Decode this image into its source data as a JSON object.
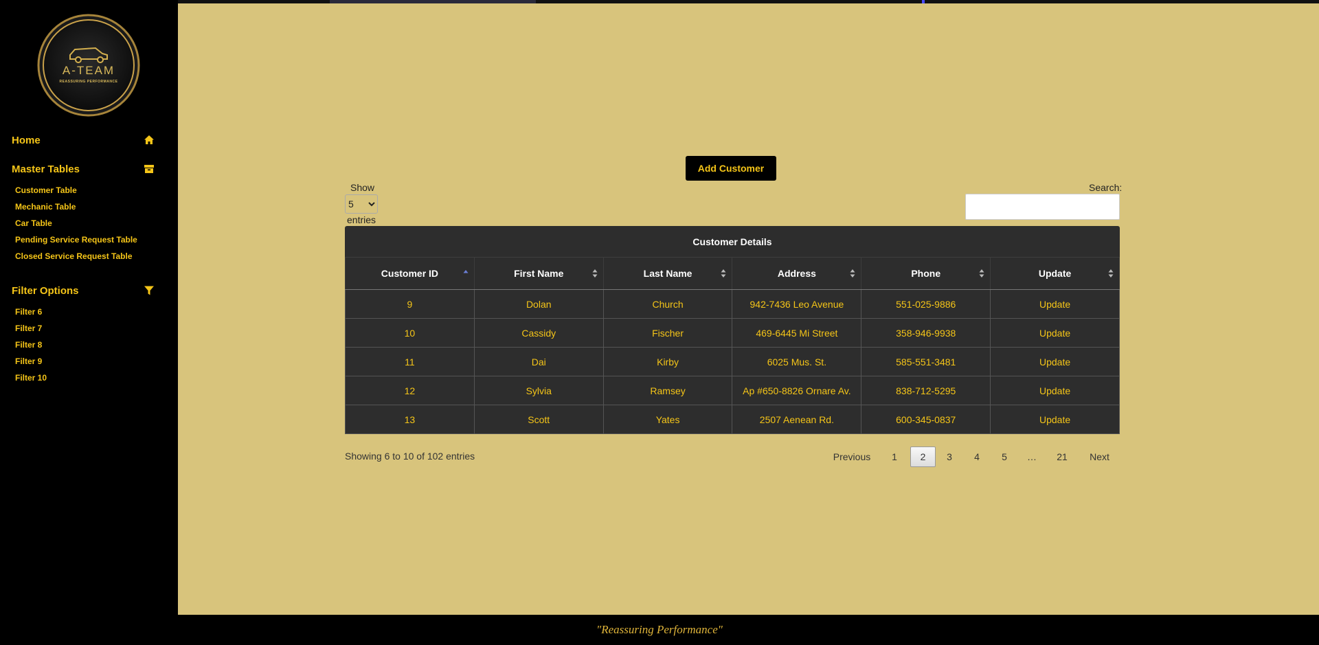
{
  "brand": {
    "logo_text": "A-TEAM",
    "logo_tagline": "REASSURING PERFORMANCE"
  },
  "sidebar": {
    "home": {
      "label": "Home",
      "icon": "home-icon"
    },
    "master": {
      "label": "Master Tables",
      "icon": "archive-icon"
    },
    "master_items": [
      {
        "label": "Customer Table"
      },
      {
        "label": "Mechanic Table"
      },
      {
        "label": "Car Table"
      },
      {
        "label": "Pending Service Request Table"
      },
      {
        "label": "Closed Service Request Table"
      }
    ],
    "filter": {
      "label": "Filter Options",
      "icon": "filter-icon"
    },
    "filter_items": [
      {
        "label": "Filter 6"
      },
      {
        "label": "Filter 7"
      },
      {
        "label": "Filter 8"
      },
      {
        "label": "Filter 9"
      },
      {
        "label": "Filter 10"
      }
    ]
  },
  "main": {
    "add_button": "Add Customer",
    "show_label": "Show",
    "entries_value": "5",
    "entries_label": "entries",
    "search_label": "Search:",
    "search_value": ""
  },
  "table": {
    "caption": "Customer Details",
    "columns": [
      "Customer ID",
      "First Name",
      "Last Name",
      "Address",
      "Phone",
      "Update"
    ],
    "sorted_column": "Customer ID",
    "rows": [
      [
        "9",
        "Dolan",
        "Church",
        "942-7436 Leo Avenue",
        "551-025-9886",
        "Update"
      ],
      [
        "10",
        "Cassidy",
        "Fischer",
        "469-6445 Mi Street",
        "358-946-9938",
        "Update"
      ],
      [
        "11",
        "Dai",
        "Kirby",
        "6025 Mus. St.",
        "585-551-3481",
        "Update"
      ],
      [
        "12",
        "Sylvia",
        "Ramsey",
        "Ap #650-8826 Ornare Av.",
        "838-712-5295",
        "Update"
      ],
      [
        "13",
        "Scott",
        "Yates",
        "2507 Aenean Rd.",
        "600-345-0837",
        "Update"
      ]
    ]
  },
  "pagination": {
    "info": "Showing 6 to 10 of 102 entries",
    "previous": "Previous",
    "pages": [
      "1",
      "2",
      "3",
      "4",
      "5",
      "…",
      "21"
    ],
    "current": "2",
    "next": "Next"
  },
  "footer": {
    "tagline": "\"Reassuring Performance\""
  },
  "colors": {
    "accent": "#f5c518",
    "main_bg": "#d8c47c",
    "table_bg": "#2d2d2d",
    "sidebar_bg": "#000000"
  }
}
